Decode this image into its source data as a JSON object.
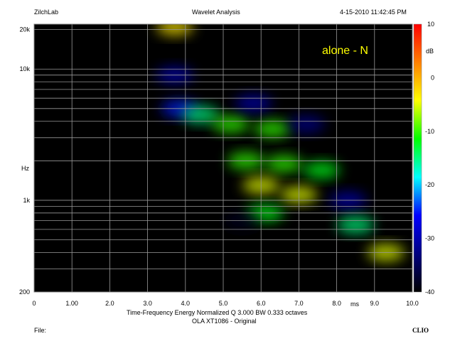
{
  "header": {
    "app": "ZilchLab",
    "title": "Wavelet Analysis",
    "timestamp": "4-15-2010 11:42:45 PM"
  },
  "footer": {
    "file_label": "File:",
    "brand": "CLIO"
  },
  "colors": {
    "plot_background": "#000000",
    "grid": "#9a9a9a",
    "annotation": "#ffff00"
  },
  "chart_data": {
    "type": "heatmap",
    "annotation": "alone - N",
    "xlabel": "ms",
    "xlim": [
      0,
      10
    ],
    "x_ticks": [
      {
        "value": 0,
        "label": "0"
      },
      {
        "value": 1,
        "label": "1.00"
      },
      {
        "value": 2,
        "label": "2.0"
      },
      {
        "value": 3,
        "label": "3.0"
      },
      {
        "value": 4,
        "label": "4.0"
      },
      {
        "value": 5,
        "label": "5.0"
      },
      {
        "value": 6,
        "label": "6.0"
      },
      {
        "value": 7,
        "label": "7.0"
      },
      {
        "value": 8,
        "label": "8.0"
      },
      {
        "value": 9,
        "label": "9.0"
      },
      {
        "value": 10,
        "label": "10.0"
      }
    ],
    "ylabel": "Hz",
    "y_scale": "log",
    "ylim": [
      200,
      22000
    ],
    "y_ticks": [
      {
        "value": 20000,
        "label": "20k"
      },
      {
        "value": 10000,
        "label": "10k"
      },
      {
        "value": 1000,
        "label": "1k"
      },
      {
        "value": 200,
        "label": "200"
      }
    ],
    "y_grid_values": [
      300,
      400,
      500,
      600,
      700,
      800,
      900,
      1000,
      2000,
      3000,
      4000,
      5000,
      6000,
      7000,
      8000,
      9000,
      10000,
      20000
    ],
    "colorbar": {
      "unit": "dB",
      "range": [
        -40,
        10
      ],
      "ticks": [
        {
          "value": 10,
          "label": "10"
        },
        {
          "value": 0,
          "label": "0"
        },
        {
          "value": -10,
          "label": "-10"
        },
        {
          "value": -20,
          "label": "-20"
        },
        {
          "value": -30,
          "label": "-30"
        },
        {
          "value": -40,
          "label": "-40"
        }
      ],
      "scale_colors": [
        "#ff0000",
        "#ff8000",
        "#ffff00",
        "#00ff00",
        "#00ffff",
        "#0000ff",
        "#000080",
        "#000000"
      ]
    },
    "caption_line1": "Time-Frequency Energy   Normalized  Q 3.000 BW 0.333 octaves",
    "caption_line2": "OLA XT1086 - Original",
    "regions": [
      {
        "t": 3.72,
        "f": 21000,
        "level": -3
      },
      {
        "t": 3.72,
        "f": 9000,
        "level": -30
      },
      {
        "t": 3.85,
        "f": 5000,
        "level": -25
      },
      {
        "t": 4.4,
        "f": 4500,
        "level": -15
      },
      {
        "t": 5.2,
        "f": 3800,
        "level": -10
      },
      {
        "t": 6.3,
        "f": 3500,
        "level": -10
      },
      {
        "t": 5.8,
        "f": 5500,
        "level": -30
      },
      {
        "t": 7.2,
        "f": 3800,
        "level": -32
      },
      {
        "t": 5.6,
        "f": 2000,
        "level": -10
      },
      {
        "t": 6.6,
        "f": 1900,
        "level": -10
      },
      {
        "t": 7.6,
        "f": 1700,
        "level": -12
      },
      {
        "t": 6.0,
        "f": 1300,
        "level": -5
      },
      {
        "t": 7.0,
        "f": 1100,
        "level": -5
      },
      {
        "t": 8.3,
        "f": 1000,
        "level": -30
      },
      {
        "t": 6.1,
        "f": 800,
        "level": -12
      },
      {
        "t": 8.5,
        "f": 650,
        "level": -15
      },
      {
        "t": 9.3,
        "f": 400,
        "level": -5
      },
      {
        "t": 5.5,
        "f": 700,
        "level": -38
      },
      {
        "t": 4.2,
        "f": 400,
        "level": -40
      }
    ]
  }
}
